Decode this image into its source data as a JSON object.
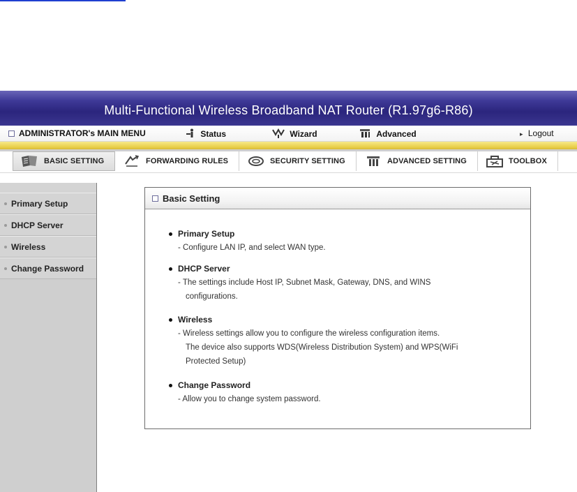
{
  "banner": {
    "title": "Multi-Functional Wireless Broadband NAT Router (R1.97g6-R86)"
  },
  "menu": {
    "main": "ADMINISTRATOR's MAIN MENU",
    "status": "Status",
    "wizard": "Wizard",
    "advanced": "Advanced",
    "logout": "Logout"
  },
  "tabs": [
    {
      "label": "BASIC SETTING",
      "icon": "basic-setting-icon",
      "active": true
    },
    {
      "label": "FORWARDING RULES",
      "icon": "forwarding-rules-icon",
      "active": false
    },
    {
      "label": "SECURITY SETTING",
      "icon": "security-setting-icon",
      "active": false
    },
    {
      "label": "ADVANCED SETTING",
      "icon": "advanced-setting-icon",
      "active": false
    },
    {
      "label": "TOOLBOX",
      "icon": "toolbox-icon",
      "active": false
    }
  ],
  "sidebar": {
    "items": [
      "Primary Setup",
      "DHCP Server",
      "Wireless",
      "Change Password"
    ]
  },
  "content": {
    "title": "Basic Setting",
    "sections": [
      {
        "heading": "Primary Setup",
        "lines": [
          "- Configure LAN IP, and select WAN type."
        ]
      },
      {
        "heading": "DHCP Server",
        "lines": [
          "- The settings include Host IP, Subnet Mask, Gateway, DNS, and WINS",
          "configurations."
        ]
      },
      {
        "heading": "Wireless",
        "lines": [
          "- Wireless settings allow you to configure the wireless configuration items.",
          "The device also supports WDS(Wireless Distribution System) and WPS(WiFi",
          "Protected Setup)"
        ]
      },
      {
        "heading": "Change Password",
        "lines": [
          "- Allow you to change system password."
        ]
      }
    ]
  },
  "colors": {
    "banner": "#2b257d",
    "gold_band": "#e9cf4a",
    "sidebar": "#cfcfcf"
  }
}
